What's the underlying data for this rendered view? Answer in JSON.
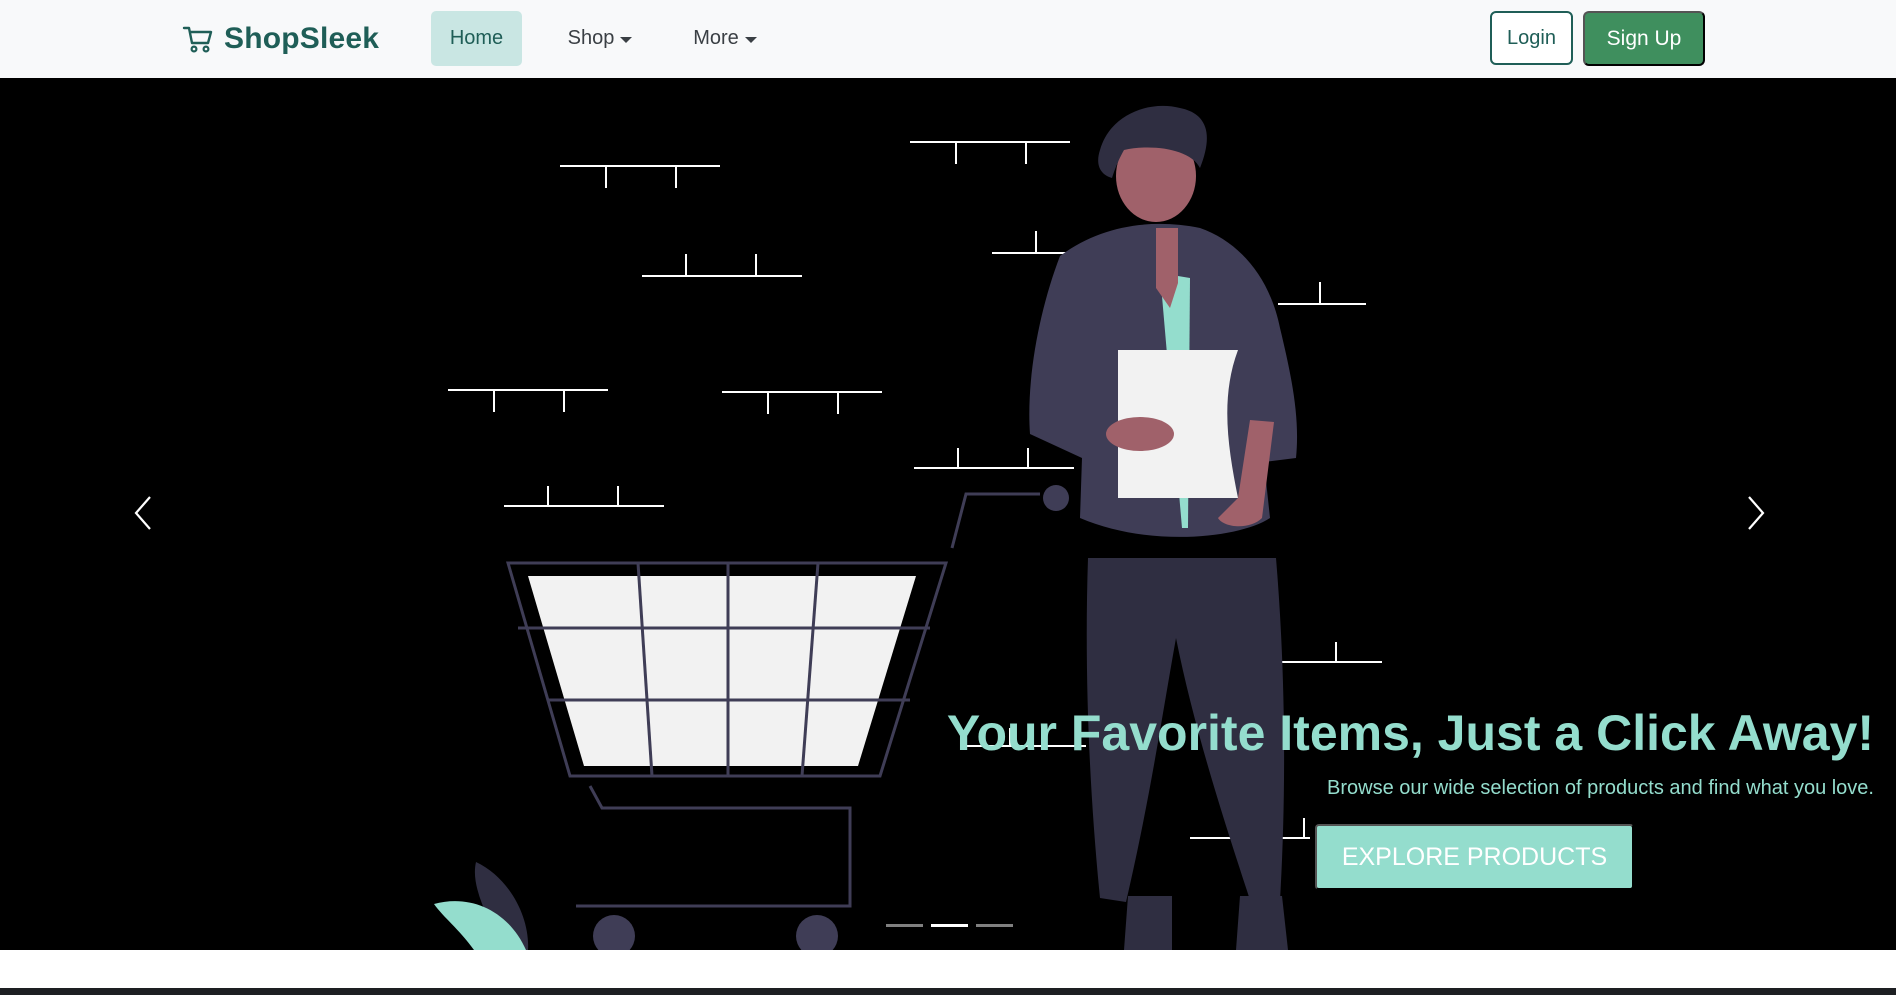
{
  "navbar": {
    "brand": {
      "name": "ShopSleek",
      "icon": "cart-icon"
    },
    "links": [
      {
        "label": "Home",
        "active": true
      },
      {
        "label": "Shop",
        "dropdown": true
      },
      {
        "label": "More",
        "dropdown": true
      }
    ],
    "login_label": "Login",
    "signup_label": "Sign Up"
  },
  "hero": {
    "title": "Your Favorite Items, Just a Click Away!",
    "subtitle": "Browse our wide selection of products and find what you love.",
    "cta_label": "EXPLORE PRODUCTS",
    "prev_icon": "chevron-left-icon",
    "next_icon": "chevron-right-icon",
    "slide_count": 3,
    "active_slide": 2
  },
  "colors": {
    "brand": "#1f5e57",
    "accent": "#94ddcd",
    "signup": "#3f8f5e",
    "home_active_bg": "#c9e6e3",
    "hero_bg": "#000000"
  }
}
